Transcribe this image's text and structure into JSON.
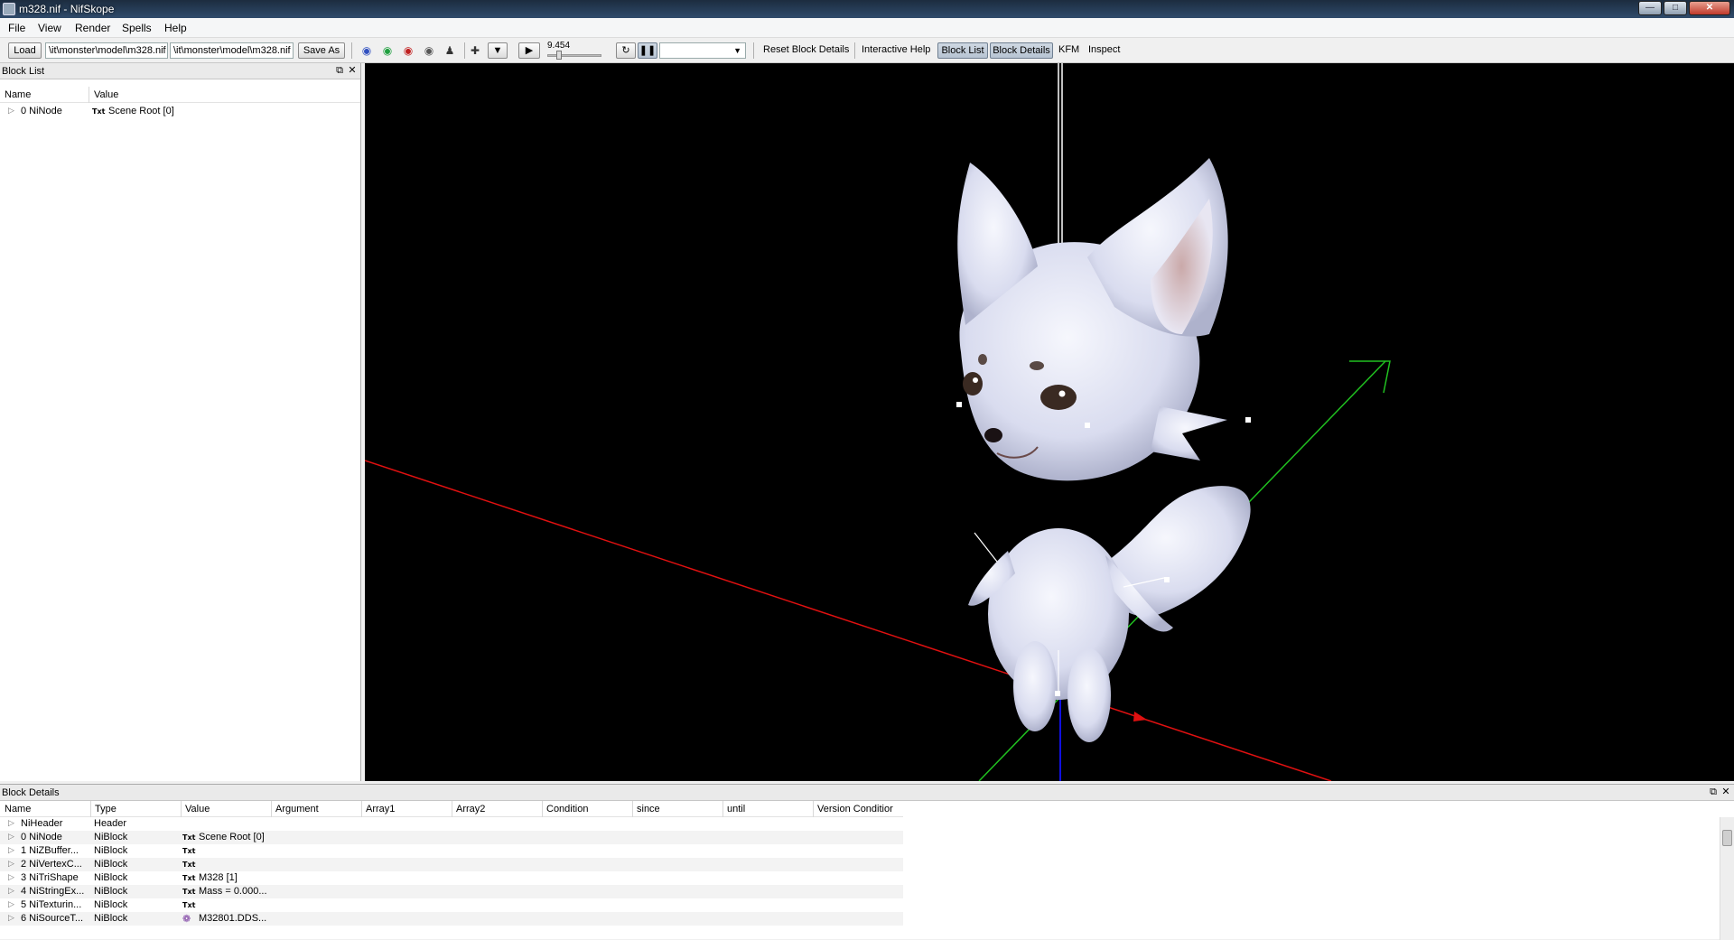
{
  "window": {
    "title": "m328.nif - NifSkope"
  },
  "menu": [
    "File",
    "View",
    "Render",
    "Spells",
    "Help"
  ],
  "toolbar": {
    "load_label": "Load",
    "load_path": "\\it\\monster\\model\\m328.nif",
    "save_path": "\\it\\monster\\model\\m328.nif",
    "save_as_label": "Save As",
    "time_value": "9.454",
    "reset_block_details": "Reset Block Details",
    "interactive_help": "Interactive Help",
    "block_list": "Block List",
    "block_details": "Block Details",
    "kfm": "KFM",
    "inspect": "Inspect"
  },
  "block_list": {
    "title": "Block List",
    "columns": [
      "Name",
      "Value"
    ],
    "rows": [
      {
        "name": "0 NiNode",
        "value": "Scene Root [0]",
        "has_txt": true
      }
    ]
  },
  "block_details": {
    "title": "Block Details",
    "columns": [
      "Name",
      "Type",
      "Value",
      "Argument",
      "Array1",
      "Array2",
      "Condition",
      "since",
      "until",
      "Version Conditior"
    ],
    "rows": [
      {
        "name": "NiHeader",
        "type": "Header",
        "value": "",
        "has_txt": false,
        "icon": ""
      },
      {
        "name": "0 NiNode",
        "type": "NiBlock",
        "value": "Scene Root [0]",
        "has_txt": true,
        "icon": "txt"
      },
      {
        "name": "1 NiZBuffer...",
        "type": "NiBlock",
        "value": "",
        "has_txt": true,
        "icon": "txt"
      },
      {
        "name": "2 NiVertexC...",
        "type": "NiBlock",
        "value": "",
        "has_txt": true,
        "icon": "txt"
      },
      {
        "name": "3 NiTriShape",
        "type": "NiBlock",
        "value": "M328 [1]",
        "has_txt": true,
        "icon": "txt"
      },
      {
        "name": "4 NiStringEx...",
        "type": "NiBlock",
        "value": "Mass = 0.000...",
        "has_txt": true,
        "icon": "txt"
      },
      {
        "name": "5 NiTexturin...",
        "type": "NiBlock",
        "value": "",
        "has_txt": true,
        "icon": "txt"
      },
      {
        "name": "6 NiSourceT...",
        "type": "NiBlock",
        "value": "M32801.DDS...",
        "has_txt": false,
        "icon": "texture"
      }
    ]
  },
  "icons": {
    "txt_icon": "Txt",
    "colors": {
      "x_axis": "#e01010",
      "y_axis": "#20c020",
      "z_axis": "#1010e0",
      "viewport_bg": "#000000"
    }
  }
}
